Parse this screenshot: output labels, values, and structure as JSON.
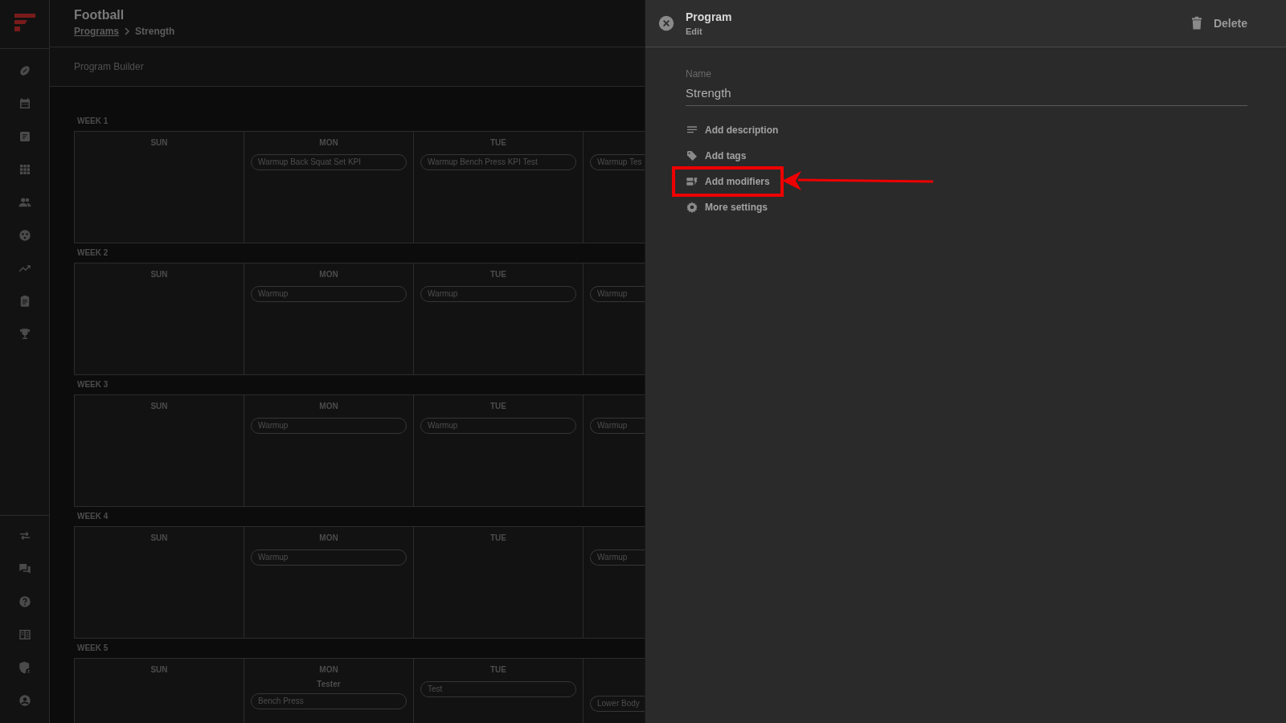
{
  "header": {
    "title": "Football",
    "breadcrumb": [
      {
        "label": "Programs",
        "link": true
      },
      {
        "label": "Strength",
        "link": false
      }
    ]
  },
  "subheader": {
    "title": "Program Builder"
  },
  "weeks": [
    {
      "label": "WEEK 1",
      "days": [
        {
          "label": "SUN"
        },
        {
          "label": "MON",
          "pills": [
            "Warmup Back Squat Set KPI"
          ]
        },
        {
          "label": "TUE",
          "pills": [
            "Warmup Bench Press KPI Test"
          ]
        },
        {
          "pills": [
            "Warmup Tes"
          ]
        }
      ]
    },
    {
      "label": "WEEK 2",
      "days": [
        {
          "label": "SUN"
        },
        {
          "label": "MON",
          "pills": [
            "Warmup"
          ]
        },
        {
          "label": "TUE",
          "pills": [
            "Warmup"
          ]
        },
        {
          "pills": [
            "Warmup"
          ]
        }
      ]
    },
    {
      "label": "WEEK 3",
      "days": [
        {
          "label": "SUN"
        },
        {
          "label": "MON",
          "pills": [
            "Warmup"
          ]
        },
        {
          "label": "TUE",
          "pills": [
            "Warmup"
          ]
        },
        {
          "pills": [
            "Warmup"
          ]
        }
      ]
    },
    {
      "label": "WEEK 4",
      "days": [
        {
          "label": "SUN"
        },
        {
          "label": "MON",
          "pills": [
            "Warmup"
          ]
        },
        {
          "label": "TUE"
        },
        {
          "pills": [
            "Warmup"
          ]
        }
      ]
    },
    {
      "label": "WEEK 5",
      "days": [
        {
          "label": "SUN"
        },
        {
          "label": "MON",
          "subtitle": "Tester",
          "pills": [
            "Bench Press"
          ]
        },
        {
          "label": "TUE",
          "pills": [
            "Test"
          ]
        },
        {
          "pills": [
            "Lower Body"
          ],
          "offset": true
        }
      ]
    }
  ],
  "panel": {
    "title": "Program",
    "subtitle": "Edit",
    "delete": "Delete",
    "name_field": {
      "label": "Name",
      "value": "Strength"
    },
    "actions": [
      {
        "kind": "description",
        "label": "Add description",
        "highlighted": false
      },
      {
        "kind": "tags",
        "label": "Add tags",
        "highlighted": false
      },
      {
        "kind": "modifiers",
        "label": "Add modifiers",
        "highlighted": true
      },
      {
        "kind": "settings",
        "label": "More settings",
        "highlighted": false
      }
    ]
  }
}
